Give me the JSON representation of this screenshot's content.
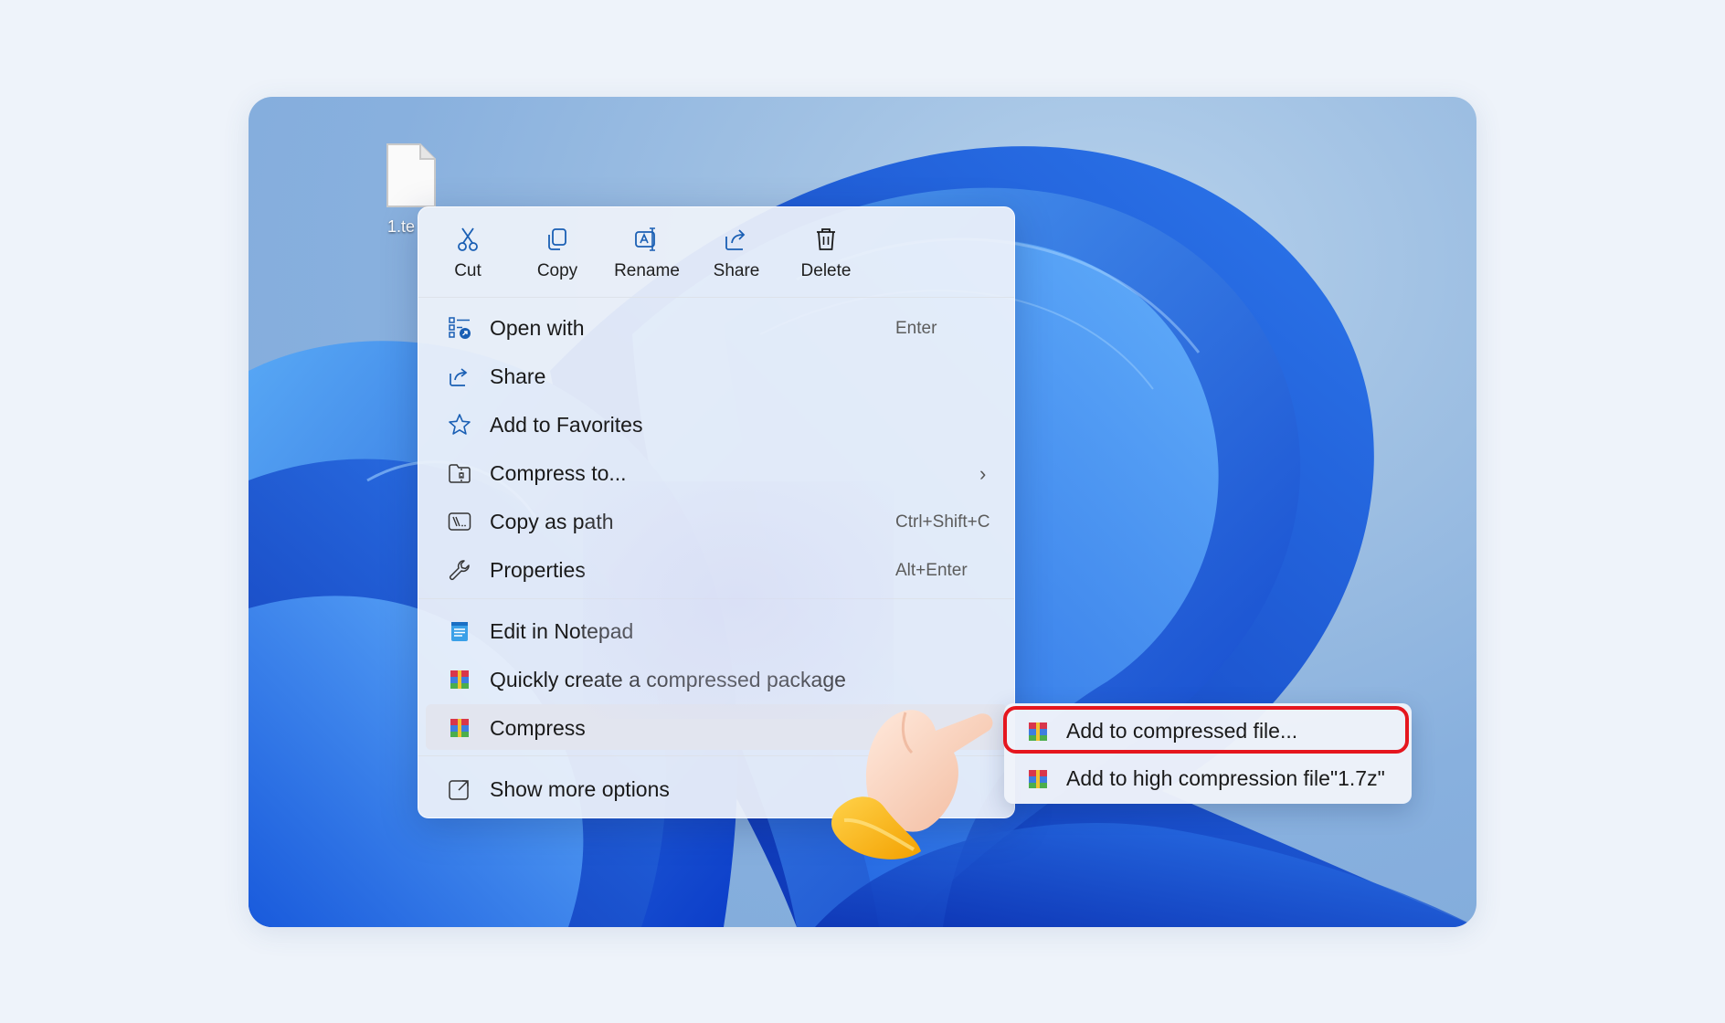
{
  "desktop": {
    "file": {
      "label": "1.te"
    }
  },
  "toolbar": [
    {
      "label": "Cut",
      "icon": "scissors-icon"
    },
    {
      "label": "Copy",
      "icon": "copy-icon"
    },
    {
      "label": "Rename",
      "icon": "rename-icon"
    },
    {
      "label": "Share",
      "icon": "share-icon"
    },
    {
      "label": "Delete",
      "icon": "trash-icon"
    }
  ],
  "items": [
    {
      "label": "Open with",
      "shortcut": "Enter",
      "icon": "open-with-icon"
    },
    {
      "label": "Share",
      "shortcut": "",
      "icon": "share-icon"
    },
    {
      "label": "Add to Favorites",
      "shortcut": "",
      "icon": "star-icon"
    },
    {
      "label": "Compress to...",
      "shortcut": "",
      "icon": "zip-folder-icon",
      "submenu": true
    },
    {
      "label": "Copy as path",
      "shortcut": "Ctrl+Shift+C",
      "icon": "path-icon"
    },
    {
      "label": "Properties",
      "shortcut": "Alt+Enter",
      "icon": "wrench-icon"
    },
    {
      "label": "Edit in Notepad",
      "shortcut": "",
      "icon": "notepad-icon"
    },
    {
      "label": "Quickly create a compressed package",
      "shortcut": "",
      "icon": "archive-icon"
    },
    {
      "label": "Compress",
      "shortcut": "",
      "icon": "archive-icon",
      "submenu": true
    },
    {
      "label": "Show more options",
      "shortcut": "",
      "icon": "expand-icon"
    }
  ],
  "submenu": [
    {
      "label": "Add to compressed file...",
      "icon": "archive-icon",
      "highlighted": true
    },
    {
      "label": "Add to high compression file\"1.7z\"",
      "icon": "archive-icon"
    }
  ],
  "colors": {
    "highlight": "#e5161e",
    "accent": "#1a5fb4",
    "wallpaper": "#1f63e0"
  }
}
